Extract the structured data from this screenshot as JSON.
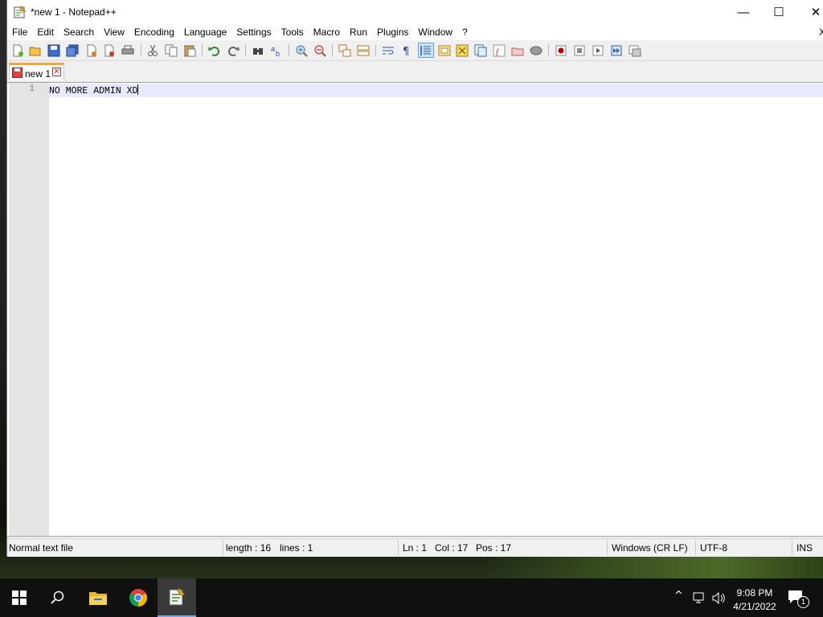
{
  "window": {
    "title": "*new 1 - Notepad++",
    "controls": {
      "minimize": "—",
      "maximize": "☐",
      "close": "✕"
    }
  },
  "menu": [
    "File",
    "Edit",
    "Search",
    "View",
    "Encoding",
    "Language",
    "Settings",
    "Tools",
    "Macro",
    "Run",
    "Plugins",
    "Window",
    "?"
  ],
  "menu_close_glyph": "X",
  "toolbar": {
    "icons": [
      "new-file-icon",
      "open-file-icon",
      "save-icon",
      "save-all-icon",
      "close-icon",
      "close-all-icon",
      "print-icon",
      "cut-icon",
      "copy-icon",
      "paste-icon",
      "undo-icon",
      "redo-icon",
      "find-icon",
      "replace-icon",
      "zoom-in-icon",
      "zoom-out-icon",
      "sync-vertical-icon",
      "sync-horizontal-icon",
      "word-wrap-icon",
      "show-all-chars-icon",
      "indent-guide-icon",
      "user-defined-language-icon",
      "document-map-icon",
      "document-list-icon",
      "function-list-icon",
      "folder-as-workspace-icon",
      "monitoring-icon",
      "record-macro-icon",
      "stop-macro-icon",
      "play-macro-icon",
      "run-macro-multiple-icon",
      "save-macro-icon"
    ]
  },
  "tabs": [
    {
      "label": "new 1",
      "close": "✕"
    }
  ],
  "editor": {
    "lines": [
      {
        "number": "1",
        "text": "NO MORE ADMIN XD"
      }
    ]
  },
  "status": {
    "file_type": "Normal text file",
    "length": "length : 16",
    "lines": "lines : 1",
    "ln": "Ln : 1",
    "col": "Col : 17",
    "pos": "Pos : 17",
    "eol": "Windows (CR LF)",
    "encoding": "UTF-8",
    "mode": "INS"
  },
  "taskbar": {
    "items": [
      "start-icon",
      "search-icon",
      "file-explorer-icon",
      "chrome-icon",
      "notepadpp-icon"
    ],
    "time": "9:08 PM",
    "date": "4/21/2022",
    "notification_count": "1"
  },
  "colors": {
    "tab_accent": "#f8a33c",
    "current_line": "#e8e8ff",
    "record_red": "#c00000"
  }
}
